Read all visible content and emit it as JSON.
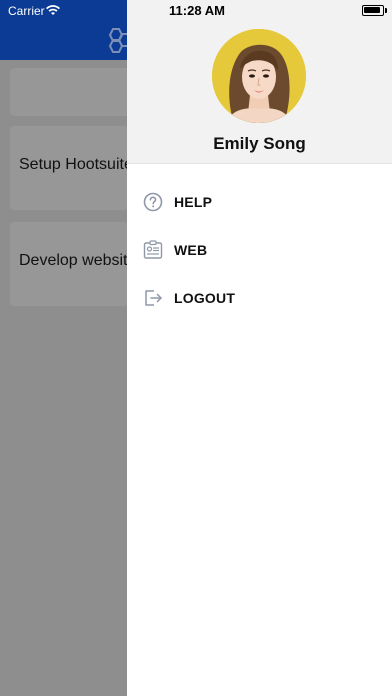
{
  "status_bar": {
    "carrier": "Carrier",
    "time": "11:28 AM"
  },
  "background": {
    "header_color": "#0b3b94",
    "cards": [
      {
        "text": ""
      },
      {
        "text": "Setup Hootsuite"
      },
      {
        "text": "Develop website"
      }
    ]
  },
  "drawer": {
    "user_name": "Emily Song",
    "menu": [
      {
        "label": "HELP",
        "icon": "help-circle-icon"
      },
      {
        "label": "WEB",
        "icon": "id-card-icon"
      },
      {
        "label": "LOGOUT",
        "icon": "logout-icon"
      }
    ]
  },
  "colors": {
    "accent_blue": "#0b3b94",
    "icon_gray": "#8e98a8",
    "avatar_bg": "#e6c93a"
  }
}
